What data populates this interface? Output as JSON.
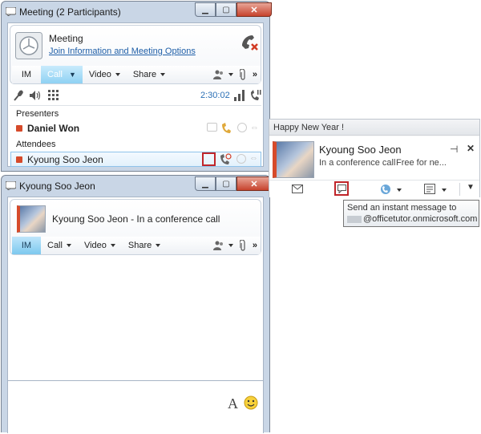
{
  "meeting_window": {
    "title": "Meeting (2 Participants)",
    "meeting_name": "Meeting",
    "join_link": "Join Information and Meeting Options",
    "toolbar": {
      "im": "IM",
      "call": "Call",
      "video": "Video",
      "share": "Share",
      "more": "»"
    },
    "timer": "2:30:02",
    "presenters_label": "Presenters",
    "presenter_name": "Daniel Won",
    "attendees_label": "Attendees",
    "attendee_name": "Kyoung Soo Jeon"
  },
  "chat_window": {
    "title": "Kyoung Soo Jeon",
    "header_text": "Kyoung Soo Jeon - In a conference call",
    "toolbar": {
      "im": "IM",
      "call": "Call",
      "video": "Video",
      "share": "Share",
      "more": "»"
    },
    "font_glyph": "A"
  },
  "contact_card": {
    "note": "Happy New Year !",
    "name": "Kyoung Soo Jeon",
    "status": "In a conference call",
    "availability": "Free for ne...",
    "tooltip_line1": "Send an instant message to",
    "tooltip_line2": "@officetutor.onmicrosoft.com"
  },
  "colors": {
    "frame": "#c9d6e6",
    "accent": "#7cc8ee",
    "alert": "#d64a2a",
    "link": "#1f5fa8"
  },
  "icons": [
    "meeting-logo-icon",
    "end-call-icon",
    "microphone-icon",
    "speaker-icon",
    "dialpad-icon",
    "signal-icon",
    "call-controls-icon",
    "im-icon",
    "phone-icon",
    "video-icon",
    "transfer-icon",
    "email-icon",
    "pin-icon",
    "close-icon",
    "font-icon",
    "emoticon-icon"
  ]
}
